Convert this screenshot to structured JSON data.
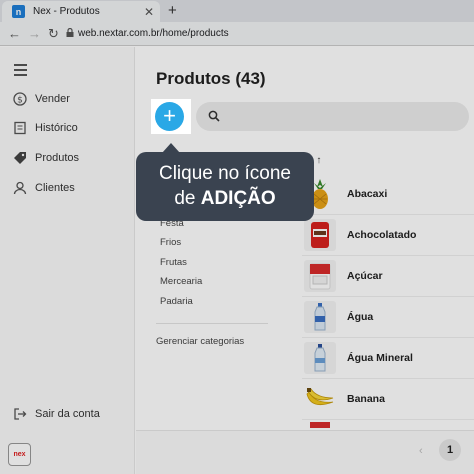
{
  "browser": {
    "tab_title": "Nex - Produtos",
    "favicon_letter": "n",
    "close_glyph": "✕",
    "newtab_glyph": "+",
    "back_glyph": "←",
    "forward_glyph": "→",
    "reload_glyph": "↻",
    "url": "web.nextar.com.br/home/products"
  },
  "sidebar": {
    "items": [
      {
        "label": "Vender",
        "icon": "dollar-icon"
      },
      {
        "label": "Histórico",
        "icon": "receipt-icon"
      },
      {
        "label": "Produtos",
        "icon": "tag-icon"
      },
      {
        "label": "Clientes",
        "icon": "person-icon"
      }
    ],
    "logout_label": "Sair da conta",
    "logo_text": "nex"
  },
  "main": {
    "title": "Produtos (43)",
    "sort_label": "e ↑",
    "categories": [
      "Festa",
      "Frios",
      "Frutas",
      "Mercearia",
      "Padaria"
    ],
    "manage_categories": "Gerenciar categorias",
    "products": [
      {
        "name": "Abacaxi"
      },
      {
        "name": "Achocolatado"
      },
      {
        "name": "Açúcar"
      },
      {
        "name": "Água"
      },
      {
        "name": "Água Mineral"
      },
      {
        "name": "Banana"
      }
    ],
    "pagination": {
      "prev": "‹",
      "current": "1"
    }
  },
  "overlay": {
    "add_glyph": "+",
    "tooltip_line1": "Clique no ícone",
    "tooltip_line2_prefix": "de",
    "tooltip_line2_bold": "ADIÇÃO"
  }
}
